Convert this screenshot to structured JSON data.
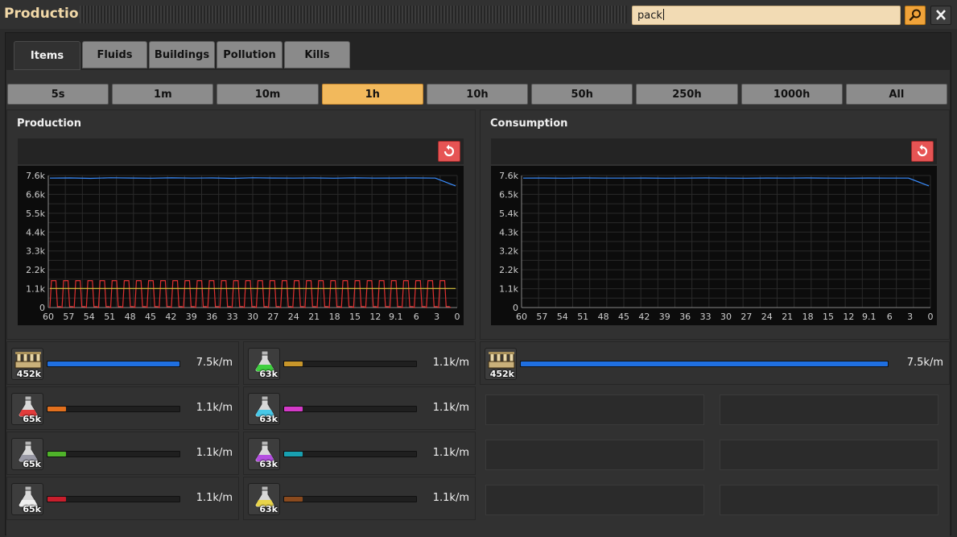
{
  "window": {
    "title": "Production"
  },
  "search": {
    "value": "pack"
  },
  "tabs": [
    {
      "label": "Items",
      "active": true
    },
    {
      "label": "Fluids",
      "active": false
    },
    {
      "label": "Buildings",
      "active": false
    },
    {
      "label": "Pollution",
      "active": false
    },
    {
      "label": "Kills",
      "active": false
    }
  ],
  "time_ranges": [
    {
      "label": "5s",
      "active": false
    },
    {
      "label": "1m",
      "active": false
    },
    {
      "label": "10m",
      "active": false
    },
    {
      "label": "1h",
      "active": true
    },
    {
      "label": "10h",
      "active": false
    },
    {
      "label": "50h",
      "active": false
    },
    {
      "label": "250h",
      "active": false
    },
    {
      "label": "1000h",
      "active": false
    },
    {
      "label": "All",
      "active": false
    }
  ],
  "colors": {
    "accent": "#f2b95c",
    "reset": "#e65454",
    "blue_series": "#3a8dff",
    "red_series": "#e03131",
    "yellow_series": "#d9c43a"
  },
  "production_panel": {
    "title": "Production"
  },
  "consumption_panel": {
    "title": "Consumption"
  },
  "chart_data": [
    {
      "type": "line",
      "title": "Production",
      "x_ticks": [
        "60",
        "57",
        "54",
        "51",
        "48",
        "45",
        "42",
        "39",
        "36",
        "33",
        "30",
        "27",
        "24",
        "21",
        "18",
        "15",
        "12",
        "9.1",
        "6",
        "3",
        "0"
      ],
      "y_ticks": [
        "7.6k",
        "6.6k",
        "5.5k",
        "4.4k",
        "3.3k",
        "2.2k",
        "1.1k",
        "0"
      ],
      "ylim": [
        0,
        7600
      ],
      "grid": true,
      "series": [
        {
          "color": "#3a8dff",
          "pattern": "flat",
          "values": [
            7450,
            7460,
            7440,
            7470,
            7455,
            7445,
            7465,
            7450,
            7460,
            7440,
            7470,
            7455,
            7450,
            7460,
            7445,
            7465,
            7450,
            7455,
            7460,
            7450,
            7000
          ]
        },
        {
          "color": "#e03131",
          "pattern": "oscillating",
          "cycles": 33,
          "min": 0,
          "max": 1550
        },
        {
          "color": "#d9c43a",
          "pattern": "flat",
          "values": [
            1100,
            1100,
            1100,
            1100,
            1100,
            1100,
            1100,
            1100,
            1100,
            1100,
            1100,
            1100,
            1100,
            1100,
            1100,
            1100,
            1100,
            1100,
            1100,
            1100,
            1100
          ]
        }
      ]
    },
    {
      "type": "line",
      "title": "Consumption",
      "x_ticks": [
        "60",
        "57",
        "54",
        "51",
        "48",
        "45",
        "42",
        "39",
        "36",
        "33",
        "30",
        "27",
        "24",
        "21",
        "18",
        "15",
        "12",
        "9.1",
        "6",
        "3",
        "0"
      ],
      "y_ticks": [
        "7.6k",
        "6.5k",
        "5.4k",
        "4.3k",
        "3.2k",
        "2.2k",
        "1.1k",
        "0"
      ],
      "ylim": [
        0,
        7600
      ],
      "grid": true,
      "series": [
        {
          "color": "#3a8dff",
          "pattern": "flat",
          "values": [
            7450,
            7455,
            7445,
            7460,
            7450,
            7450,
            7455,
            7445,
            7450,
            7460,
            7450,
            7445,
            7455,
            7450,
            7460,
            7450,
            7445,
            7455,
            7450,
            7450,
            7000
          ]
        }
      ]
    }
  ],
  "production_items": [
    {
      "icon": "lab-icon",
      "count": "452k",
      "rate": "7.5k/m",
      "fill_fraction": 1.0,
      "bar_color": "#1f6fe0",
      "flask_color": null
    },
    {
      "icon": "green-science-pack-icon",
      "count": "63k",
      "rate": "1.1k/m",
      "fill_fraction": 0.14,
      "bar_color": "#c8962a",
      "flask_color": "#3fcf3f"
    },
    {
      "icon": "red-science-pack-icon",
      "count": "65k",
      "rate": "1.1k/m",
      "fill_fraction": 0.14,
      "bar_color": "#e2701e",
      "flask_color": "#e23b3b"
    },
    {
      "icon": "blue-science-pack-icon",
      "count": "63k",
      "rate": "1.1k/m",
      "fill_fraction": 0.14,
      "bar_color": "#d43ac8",
      "flask_color": "#47c8e8"
    },
    {
      "icon": "military-science-pack-icon",
      "count": "65k",
      "rate": "1.1k/m",
      "fill_fraction": 0.14,
      "bar_color": "#4fb32a",
      "flask_color": "#9a9aa6"
    },
    {
      "icon": "purple-science-pack-icon",
      "count": "63k",
      "rate": "1.1k/m",
      "fill_fraction": 0.14,
      "bar_color": "#18a0b0",
      "flask_color": "#b44fe0"
    },
    {
      "icon": "space-science-pack-icon",
      "count": "65k",
      "rate": "1.1k/m",
      "fill_fraction": 0.14,
      "bar_color": "#c81e2c",
      "flask_color": "#f0f0f0"
    },
    {
      "icon": "yellow-science-pack-icon",
      "count": "63k",
      "rate": "1.1k/m",
      "fill_fraction": 0.14,
      "bar_color": "#8a4a1e",
      "flask_color": "#e8d44a"
    }
  ],
  "consumption_items": [
    {
      "icon": "lab-icon",
      "count": "452k",
      "rate": "7.5k/m",
      "fill_fraction": 1.0,
      "bar_color": "#1f6fe0"
    }
  ]
}
